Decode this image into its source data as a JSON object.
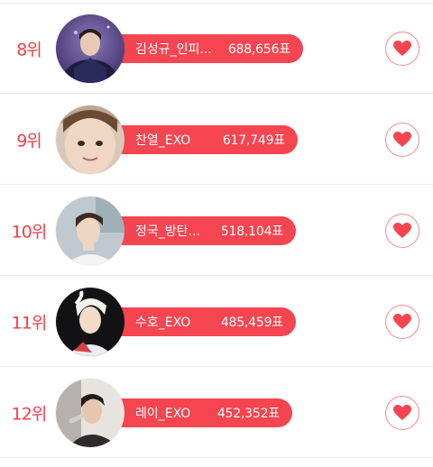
{
  "colors": {
    "accent": "#f54550",
    "rank_text": "#f0414a",
    "heart_border": "#f58a90",
    "divider": "#ececec"
  },
  "ranking": [
    {
      "rank": "8위",
      "name": "김성규_인피...",
      "votes": "688,656표",
      "avatar": "person-photo-dark-jacket"
    },
    {
      "rank": "9위",
      "name": "찬열_EXO",
      "votes": "617,749표",
      "avatar": "person-photo-closeup"
    },
    {
      "rank": "10위",
      "name": "정국_방탄...",
      "votes": "518,104표",
      "avatar": "person-photo-white-shirt"
    },
    {
      "rank": "11위",
      "name": "수호_EXO",
      "votes": "485,459표",
      "avatar": "person-photo-white-hair"
    },
    {
      "rank": "12위",
      "name": "레이_EXO",
      "votes": "452,352표",
      "avatar": "person-photo-microphone"
    }
  ],
  "vote_button_icon": "heart-icon"
}
